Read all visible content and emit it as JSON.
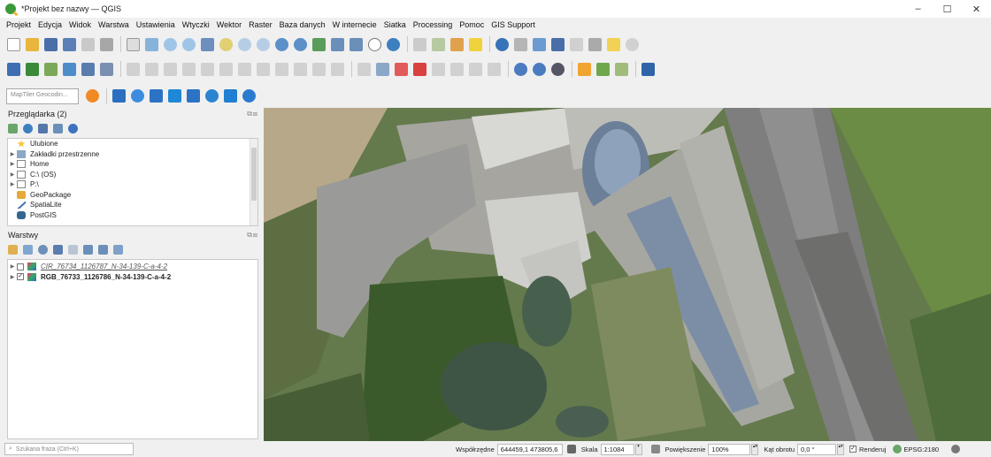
{
  "window": {
    "title": "*Projekt bez nazwy — QGIS",
    "controls": [
      "–",
      "☐",
      "✕"
    ]
  },
  "menubar": {
    "items": [
      "Projekt",
      "Edycja",
      "Widok",
      "Warstwa",
      "Ustawienia",
      "Wtyczki",
      "Wektor",
      "Raster",
      "Baza danych",
      "W internecie",
      "Siatka",
      "Processing",
      "Pomoc",
      "GIS Support"
    ]
  },
  "toolbar3": {
    "geocoder_placeholder": "MapTiler Geocodin..."
  },
  "browser_panel": {
    "title": "Przeglądarka (2)",
    "items": [
      {
        "label": "Ulubione",
        "icon": "star-icon",
        "expand": false
      },
      {
        "label": "Zakładki przestrzenne",
        "icon": "bookmark-icon",
        "expand": true
      },
      {
        "label": "Home",
        "icon": "home-folder-icon",
        "expand": true
      },
      {
        "label": "C:\\ (OS)",
        "icon": "drive-icon",
        "expand": true
      },
      {
        "label": "P:\\",
        "icon": "drive-icon",
        "expand": true
      },
      {
        "label": "GeoPackage",
        "icon": "geopackage-icon",
        "expand": false
      },
      {
        "label": "SpatiaLite",
        "icon": "spatialite-icon",
        "expand": false
      },
      {
        "label": "PostGIS",
        "icon": "postgis-icon",
        "expand": false
      }
    ]
  },
  "layers_panel": {
    "title": "Warstwy",
    "layers": [
      {
        "name": "CIR_76734_1126787_N-34-139-C-a-4-2",
        "visible": false
      },
      {
        "name": "RGB_76733_1126786_N-34-139-C-a-4-2",
        "visible": true
      }
    ]
  },
  "statusbar": {
    "locator_placeholder": "Szukana fraza (Ctrl+K)",
    "coordinate_label": "Współrzędne",
    "coordinate_value": "644459,1 473805,6",
    "scale_label": "Skala",
    "scale_value": "1:1084",
    "magnifier_label": "Powiększenie",
    "magnifier_value": "100%",
    "rotation_label": "Kąt obrotu",
    "rotation_value": "0,0 °",
    "render_label": "Renderuj",
    "crs_label": "EPSG:2180"
  },
  "colors": {
    "qgis_green": "#3a9a3a",
    "qgis_yellow": "#f2b233",
    "panel_bg": "#f0f0f0"
  }
}
